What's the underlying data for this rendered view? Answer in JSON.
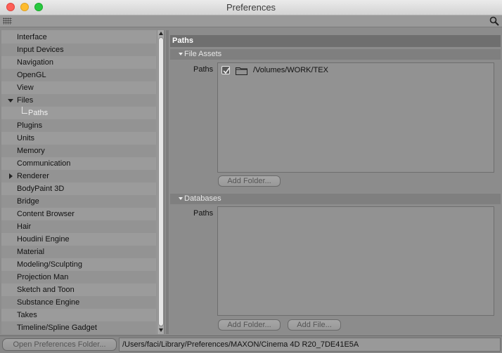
{
  "window": {
    "title": "Preferences"
  },
  "tree": {
    "items": [
      {
        "label": "Interface",
        "expander": "none"
      },
      {
        "label": "Input Devices",
        "expander": "none"
      },
      {
        "label": "Navigation",
        "expander": "none"
      },
      {
        "label": "OpenGL",
        "expander": "none"
      },
      {
        "label": "View",
        "expander": "none"
      },
      {
        "label": "Files",
        "expander": "expanded"
      },
      {
        "label": "Paths",
        "expander": "none",
        "child": true,
        "selected": true
      },
      {
        "label": "Plugins",
        "expander": "none"
      },
      {
        "label": "Units",
        "expander": "none"
      },
      {
        "label": "Memory",
        "expander": "none"
      },
      {
        "label": "Communication",
        "expander": "none"
      },
      {
        "label": "Renderer",
        "expander": "collapsed"
      },
      {
        "label": "BodyPaint 3D",
        "expander": "none"
      },
      {
        "label": "Bridge",
        "expander": "none"
      },
      {
        "label": "Content Browser",
        "expander": "none"
      },
      {
        "label": "Hair",
        "expander": "none"
      },
      {
        "label": "Houdini Engine",
        "expander": "none"
      },
      {
        "label": "Material",
        "expander": "none"
      },
      {
        "label": "Modeling/Sculpting",
        "expander": "none"
      },
      {
        "label": "Projection Man",
        "expander": "none"
      },
      {
        "label": "Sketch and Toon",
        "expander": "none"
      },
      {
        "label": "Substance Engine",
        "expander": "none"
      },
      {
        "label": "Takes",
        "expander": "none"
      },
      {
        "label": "Timeline/Spline Gadget",
        "expander": "none"
      }
    ]
  },
  "panel": {
    "header": "Paths",
    "file_assets": {
      "header": "File Assets",
      "paths_label": "Paths",
      "entries": [
        {
          "path": "/Volumes/WORK/TEX",
          "checked": true
        }
      ],
      "add_folder_label": "Add Folder..."
    },
    "databases": {
      "header": "Databases",
      "paths_label": "Paths",
      "add_folder_label": "Add Folder...",
      "add_file_label": "Add File..."
    }
  },
  "statusbar": {
    "open_button_label": "Open Preferences Folder...",
    "path": "/Users/faci/Library/Preferences/MAXON/Cinema 4D R20_7DE41E5A"
  },
  "colors": {
    "selected_text": "#f2f2f2",
    "panel_header": "#6f6f6f",
    "close": "#fd5f57",
    "minimize": "#febc2e",
    "maximize": "#28c840"
  },
  "icons": [
    "grid-icon",
    "search-icon",
    "check-icon",
    "folder-icon",
    "chevron-down-icon",
    "chevron-right-icon"
  ]
}
